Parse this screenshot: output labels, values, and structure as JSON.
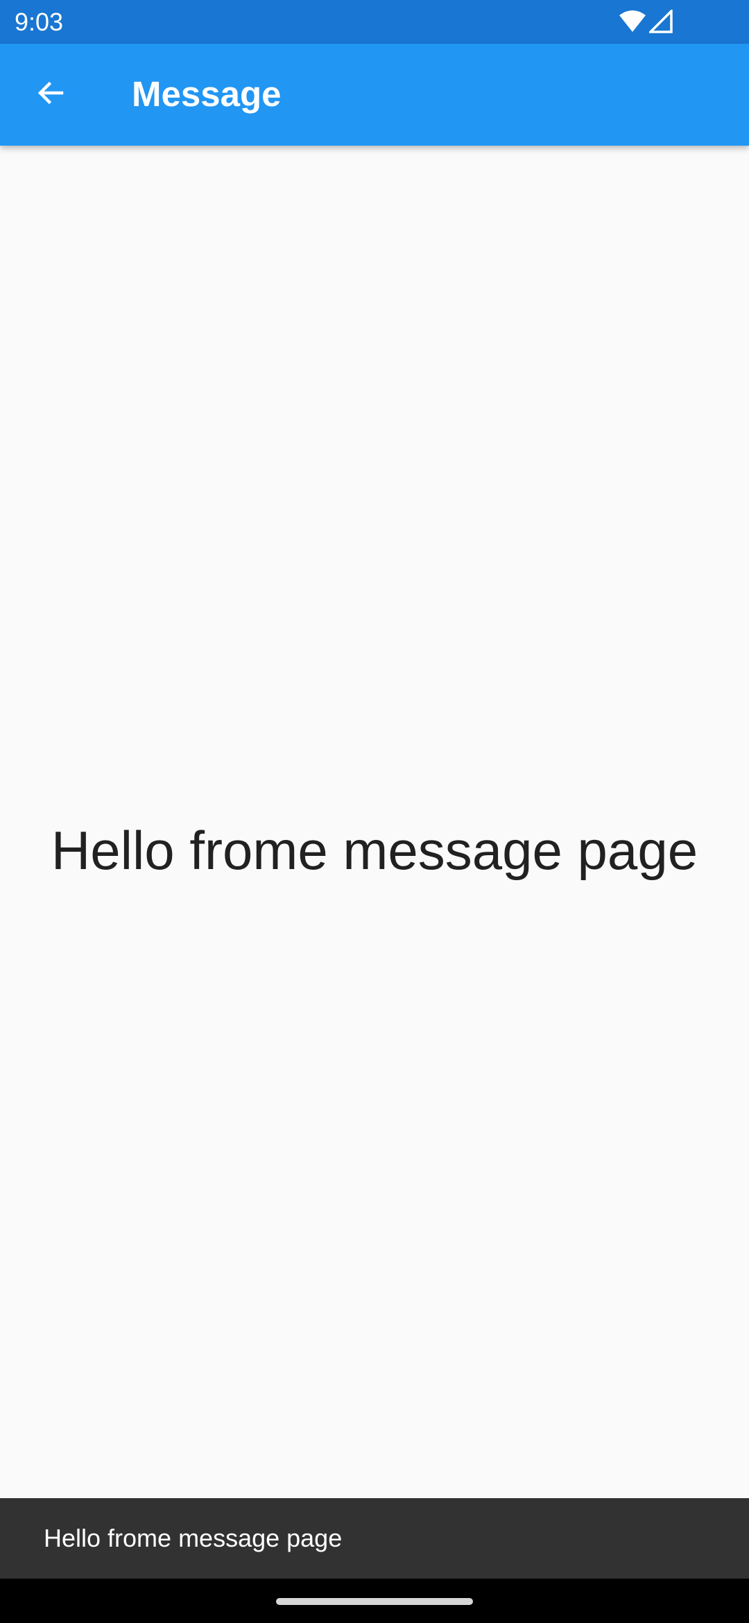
{
  "status_bar": {
    "time": "9:03",
    "icons": [
      "wifi-icon",
      "cell-signal-icon"
    ],
    "background": "#1976d2"
  },
  "app_bar": {
    "title": "Message",
    "back_icon": "arrow-back-icon",
    "background": "#2196f3"
  },
  "body": {
    "text": "Hello frome message page"
  },
  "snackbar": {
    "text": "Hello frome message page",
    "background": "#323232"
  },
  "nav_bar": {
    "background": "#000000"
  }
}
